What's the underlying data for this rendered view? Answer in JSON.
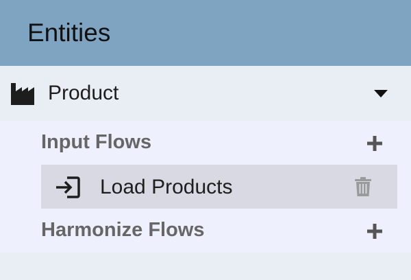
{
  "header": {
    "title": "Entities",
    "background": "#7fa4c2"
  },
  "entity": {
    "label": "Product",
    "icon": "factory-icon",
    "expand_icon": "caret-down-icon",
    "expanded": true
  },
  "sections": {
    "input_flows": {
      "title": "Input Flows",
      "add_icon": "plus-icon",
      "items": [
        {
          "label": "Load Products",
          "icon": "sign-in-icon",
          "delete_icon": "trash-icon"
        }
      ]
    },
    "harmonize_flows": {
      "title": "Harmonize Flows",
      "add_icon": "plus-icon",
      "items": []
    }
  },
  "colors": {
    "panel_background": "#e9edf4",
    "flows_background": "#eff0fd",
    "selected_row": "#d9d9e3",
    "section_title": "#666666"
  }
}
